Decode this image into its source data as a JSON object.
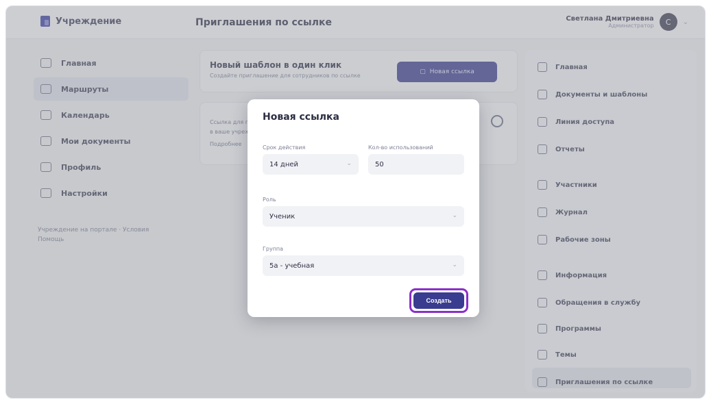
{
  "app": {
    "logo_text": "Учреждение",
    "page_title": "Приглашения по ссылке"
  },
  "user": {
    "name": "Светлана Дмитриевна",
    "role": "Администратор",
    "avatar_initial": "С"
  },
  "nav": {
    "items": [
      {
        "label": "Главная"
      },
      {
        "label": "Маршруты"
      },
      {
        "label": "Календарь"
      },
      {
        "label": "Мои документы"
      },
      {
        "label": "Профиль"
      },
      {
        "label": "Настройки"
      }
    ],
    "footer": [
      "Учреждение на портале · Условия",
      "Помощь"
    ]
  },
  "main": {
    "card1_title": "Новый шаблон в один клик",
    "card1_sub": "Создайте приглашение для сотрудников по ссылке",
    "card1_button": "Новая ссылка",
    "card2_lines": [
      "Ссылка для приглашения сотрудников",
      "в ваше учреждение",
      "Подробнее"
    ]
  },
  "right": {
    "items": [
      {
        "label": "Главная"
      },
      {
        "label": "Документы и шаблоны"
      },
      {
        "label": "Линия доступа"
      },
      {
        "label": "Отчеты"
      },
      {
        "label": "Участники"
      },
      {
        "label": "Журнал"
      },
      {
        "label": "Рабочие зоны"
      },
      {
        "label": "Информация"
      },
      {
        "label": "Обращения в службу"
      },
      {
        "label": "Программы"
      },
      {
        "label": "Темы"
      },
      {
        "label": "Приглашения по ссылке"
      }
    ]
  },
  "modal": {
    "title": "Новая ссылка",
    "validity_label": "Срок действия",
    "validity_value": "14 дней",
    "uses_label": "Кол-во использований",
    "uses_value": "50",
    "role_label": "Роль",
    "role_value": "Ученик",
    "group_label": "Группа",
    "group_value": "5а - учебная",
    "save_button": "Создать"
  }
}
